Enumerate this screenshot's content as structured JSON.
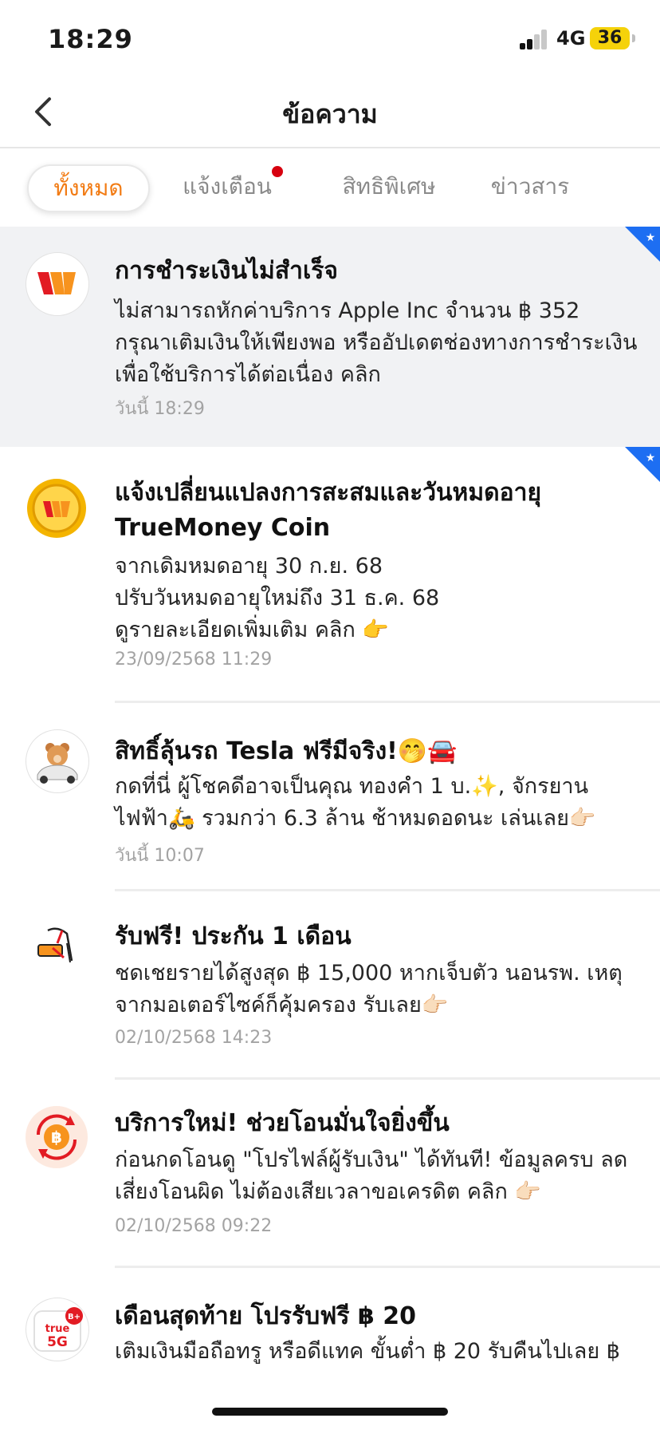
{
  "status": {
    "time": "18:29",
    "network": "4G",
    "battery": "36"
  },
  "nav": {
    "title": "ข้อความ"
  },
  "tabs": [
    {
      "label": "ทั้งหมด",
      "active": true
    },
    {
      "label": "แจ้งเตือน",
      "has_dot": true
    },
    {
      "label": "สิทธิพิเศษ"
    },
    {
      "label": "ข่าวสาร"
    }
  ],
  "messages": [
    {
      "title": "การชำระเงินไม่สำเร็จ",
      "body": "ไม่สามารถหักค่าบริการ Apple Inc จำนวน ฿ 352 กรุณาเติมเงินให้เพียงพอ หรืออัปเดตช่องทางการชำระเงินเพื่อใช้บริการได้ต่อเนื่อง คลิก",
      "time": "วันนี้ 18:29",
      "icon": "truemoney-logo-icon"
    },
    {
      "title": "แจ้งเปลี่ยนแปลงการสะสมและวันหมดอายุ TrueMoney Coin",
      "body": "จากเดิมหมดอายุ 30 ก.ย. 68\nปรับวันหมดอายุใหม่ถึง 31 ธ.ค. 68\nดูรายละเอียดเพิ่มเติม คลิก 👉",
      "time": "23/09/2568 11:29",
      "icon": "coin-icon"
    },
    {
      "title": "สิทธิ์ลุ้นรถ Tesla ฟรีมีจริง!🤭🚘",
      "body": "กดที่นี่ ผู้โชคดีอาจเป็นคุณ ทองคำ 1 บ.✨, จักรยานไฟฟ้า🛵 รวมกว่า 6.3 ล้าน ช้าหมดอดนะ เล่นเลย👉🏻",
      "time": "วันนี้ 10:07",
      "icon": "bear-car-icon"
    },
    {
      "title": "รับฟรี! ประกัน 1 เดือน",
      "body": "ชดเชยรายได้สูงสุด ฿ 15,000 หากเจ็บตัว นอนรพ. เหตุจากมอเตอร์ไซค์ก็คุ้มครอง รับเลย👉🏻",
      "time": "02/10/2568 14:23",
      "icon": "injured-arm-icon"
    },
    {
      "title": "บริการใหม่! ช่วยโอนมั่นใจยิ่งขึ้น",
      "body": "ก่อนกดโอนดู \"โปรไฟล์ผู้รับเงิน\" ได้ทันที! ข้อมูลครบ ลดเสี่ยงโอนผิด ไม่ต้องเสียเวลาขอเครดิต คลิก 👉🏻",
      "time": "02/10/2568 09:22",
      "icon": "transfer-baht-icon"
    },
    {
      "title": "เดือนสุดท้าย โปรรับฟรี ฿ 20",
      "body": "เติมเงินมือถือทรู หรือดีแทค ขั้นต่ำ ฿ 20 รับคืนไปเลย ฿",
      "time": "",
      "icon": "true-5g-icon",
      "logo_text": {
        "brand": "true",
        "tech": "5G",
        "badge": "B+"
      }
    }
  ]
}
